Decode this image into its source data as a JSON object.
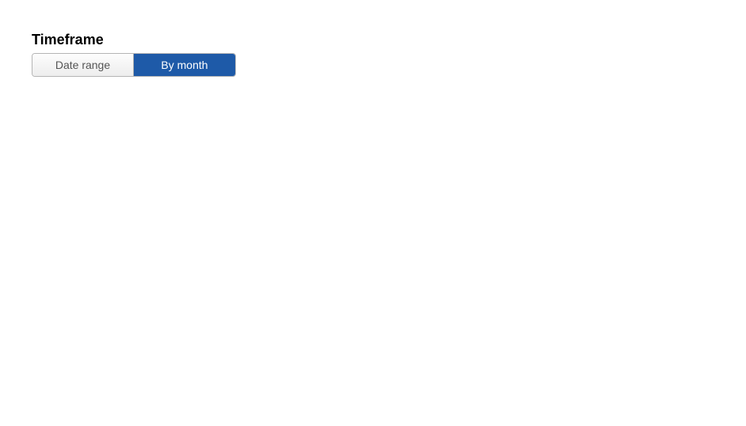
{
  "timeframe": {
    "title": "Timeframe",
    "options": {
      "date_range": "Date range",
      "by_month": "By month"
    }
  }
}
